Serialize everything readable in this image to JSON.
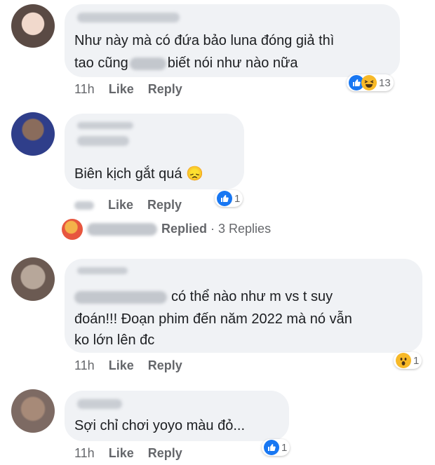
{
  "comments": [
    {
      "text_line1": "Như này mà có đứa bảo luna đóng giả thì",
      "text_line2_a": "tao cũng",
      "text_line2_b": "biết nói như nào nữa",
      "time": "11h",
      "like": "Like",
      "reply": "Reply",
      "reactions": [
        "like-icon",
        "haha-icon"
      ],
      "reaction_count": "13"
    },
    {
      "text": "Biên kịch gắt quá 😞",
      "like": "Like",
      "reply": "Reply",
      "reactions": [
        "like-icon"
      ],
      "reaction_count": "1",
      "replies_label": "Replied",
      "replies_count": "· 3 Replies"
    },
    {
      "text_line1": "có thể nào như m vs t suy",
      "text_line2": "đoán!!! Đoạn phim đến năm 2022 mà nó vẫn",
      "text_line3": "ko lớn lên đc",
      "time": "11h",
      "like": "Like",
      "reply": "Reply",
      "reactions": [
        "wow-icon"
      ],
      "reaction_count": "1"
    },
    {
      "text": "Sợi chỉ chơi yoyo màu đỏ...",
      "time": "11h",
      "like": "Like",
      "reply": "Reply",
      "reactions": [
        "like-icon"
      ],
      "reaction_count": "1"
    }
  ],
  "colors": {
    "bubble": "#f0f2f5",
    "meta": "#65676b",
    "like_blue": "#1877f2",
    "haha_yellow": "#f7b928"
  }
}
